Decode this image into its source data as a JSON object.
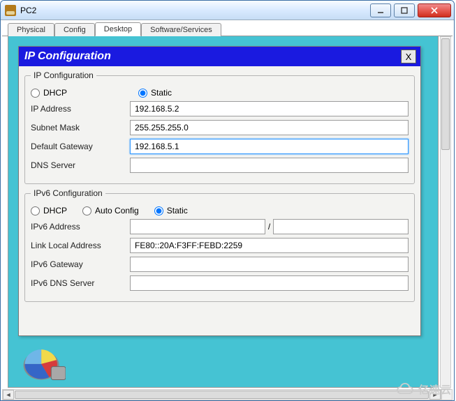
{
  "window": {
    "title": "PC2"
  },
  "tabs": [
    {
      "label": "Physical",
      "active": false
    },
    {
      "label": "Config",
      "active": false
    },
    {
      "label": "Desktop",
      "active": true
    },
    {
      "label": "Software/Services",
      "active": false
    }
  ],
  "dialog": {
    "title": "IP Configuration",
    "close_label": "X",
    "ipv4": {
      "legend": "IP Configuration",
      "radios": {
        "dhcp": "DHCP",
        "static": "Static",
        "selected": "static"
      },
      "ip_label": "IP Address",
      "ip_value": "192.168.5.2",
      "mask_label": "Subnet Mask",
      "mask_value": "255.255.255.0",
      "gw_label": "Default Gateway",
      "gw_value": "192.168.5.1",
      "dns_label": "DNS Server",
      "dns_value": ""
    },
    "ipv6": {
      "legend": "IPv6 Configuration",
      "radios": {
        "dhcp": "DHCP",
        "auto": "Auto Config",
        "static": "Static",
        "selected": "static"
      },
      "addr_label": "IPv6 Address",
      "addr_value": "",
      "prefix": "",
      "ll_label": "Link Local Address",
      "ll_value": "FE80::20A:F3FF:FEBD:2259",
      "gw_label": "IPv6 Gateway",
      "gw_value": "",
      "dns_label": "IPv6 DNS Server",
      "dns_value": ""
    }
  },
  "watermark": "亿速云"
}
